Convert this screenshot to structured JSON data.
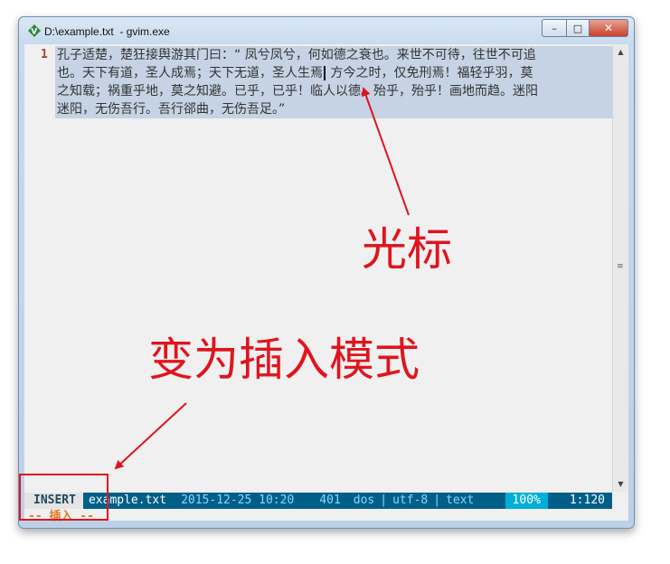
{
  "window": {
    "title": "D:\\example.txt  - gvim.exe",
    "controls": {
      "minimize": "–",
      "maximize": "□",
      "close": "✕"
    }
  },
  "editor": {
    "line_number": "1",
    "lines": [
      "孔子适楚，楚狂接舆游其门曰：“ 凤兮凤兮，何如德之衰也。来世不可待，往世不可追",
      "也。天下有道，圣人成焉；天下无道，圣人生焉",
      "之知载；祸重乎地，莫之知避。已乎，已乎！临人以德。殆乎，殆乎！画地而趋。迷阳",
      "迷阳，无伤吾行。吾行郤曲，无伤吾足。”"
    ],
    "line2_after_cursor": " 方今之时，仅免刑焉！福轻乎羽，莫"
  },
  "statusline": {
    "mode": "INSERT",
    "filename": "example.txt",
    "datetime": "2015-12-25 10:20",
    "bytes": "401",
    "fileformat": "dos",
    "encoding": "utf-8",
    "filetype": "text",
    "percent": "100%",
    "position": "1:120",
    "separator": "|"
  },
  "cmdline": {
    "text": "-- 插入 --"
  },
  "annotations": {
    "cursor_label": "光标",
    "mode_label": "变为插入模式",
    "color": "#e0141e"
  },
  "colors": {
    "selection": "#c5d3e4",
    "statusline_bg": "#005f87",
    "percent_bg": "#00afd7",
    "cmdline_text": "#e07a1f",
    "line_number": "#b03a2e"
  }
}
